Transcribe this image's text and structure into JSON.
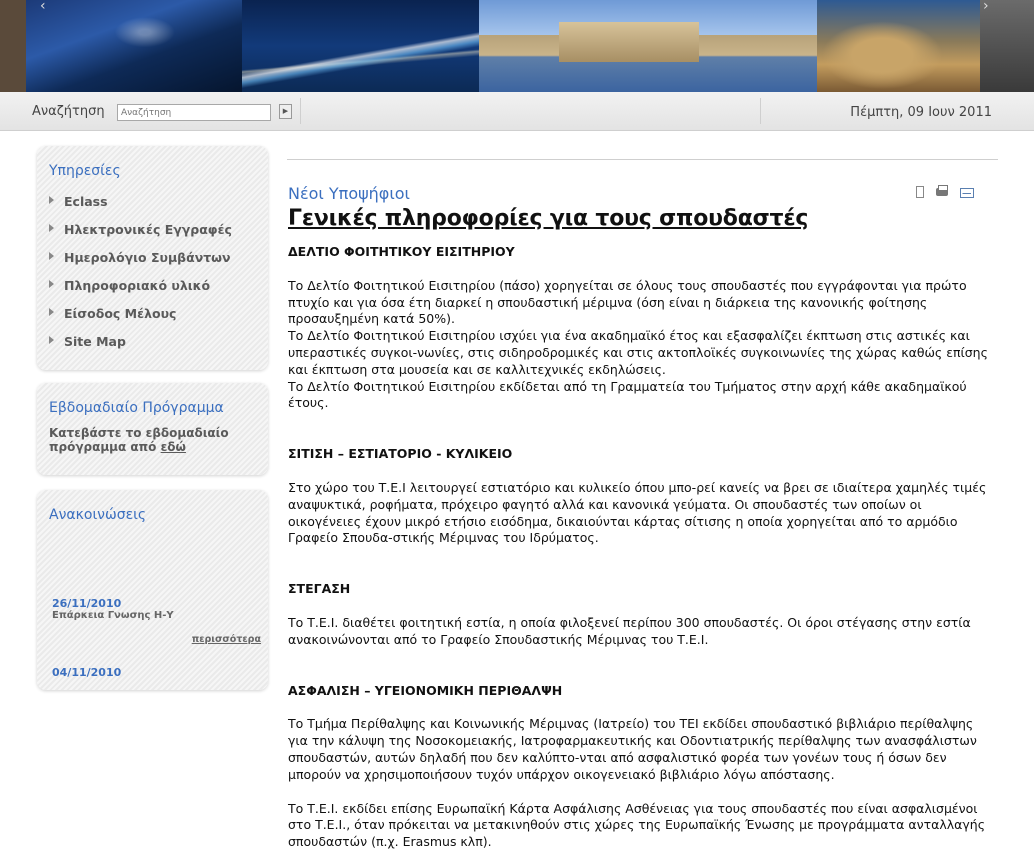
{
  "banner": {
    "arrow_left": "‹",
    "arrow_right": "›"
  },
  "search": {
    "label": "Αναζήτηση",
    "placeholder": "Αναζήτηση",
    "go_icon": "play-arrow-icon",
    "go_glyph": "▶",
    "date": "Πέμπτη, 09 Ιουν 2011"
  },
  "sidebar": {
    "services": {
      "title": "Υπηρεσίες",
      "items": [
        "Eclass",
        "Ηλεκτρονικές Εγγραφές",
        "Ημερολόγιο Συμβάντων",
        "Πληροφοριακό υλικό",
        "Είσοδος Μέλους",
        "Site Map"
      ]
    },
    "weekly": {
      "title": "Εβδομαδιαίο Πρόγραμμα",
      "text": "Κατεβάστε το εβδομαδιαίο πρόγραμμα από",
      "link": "εδώ"
    },
    "announcements": {
      "title": "Ανακοινώσεις",
      "items": [
        {
          "date": "26/11/2010",
          "text": "Επάρκεια Γνωσης Η-Υ"
        },
        {
          "date": "04/11/2010",
          "text": ""
        }
      ],
      "more": "περισσότερα"
    }
  },
  "main": {
    "section": "Νέοι Υποψήφιοι",
    "title": "Γενικές πληροφορίες για τους σπουδαστές",
    "icons": [
      "pdf-icon",
      "print-icon",
      "email-icon"
    ],
    "blocks": [
      {
        "heading": "ΔΕΛΤΙΟ ΦΟΙΤΗΤΙΚΟΥ ΕΙΣΙΤΗΡΙΟΥ",
        "paragraphs": [
          "Το Δελτίο Φοιτητικού Εισιτηρίου (πάσο) χορηγείται σε όλους τους σπουδαστές που εγγράφονται για πρώτο πτυχίο και για όσα έτη διαρκεί η σπουδαστική μέριμνα (όση είναι η διάρκεια της κανονικής φοίτησης προσαυξημένη κατά 50%).",
          "Το Δελτίο Φοιτητικού Εισιτηρίου ισχύει για ένα ακαδημαϊκό έτος και εξασφαλίζει έκπτωση στις αστικές και υπεραστικές συγκοι-νωνίες, στις σιδηροδρομικές και στις ακτοπλοϊκές συγκοινωνίες της χώρας καθώς επίσης και έκπτωση στα μουσεία και σε καλλιτεχνικές εκδηλώσεις.",
          "Το Δελτίο Φοιτητικού Εισιτηρίου εκδίδεται από τη Γραμματεία του Τμήματος στην αρχή κάθε ακαδημαϊκού έτους."
        ]
      },
      {
        "heading": "ΣΙΤΙΣΗ – ΕΣΤΙΑΤΟΡΙΟ - ΚΥΛΙΚΕΙΟ",
        "paragraphs": [
          "Στο χώρο του Τ.Ε.Ι λειτουργεί εστιατόριο και κυλικείο όπου μπο-ρεί κανείς να βρει σε ιδιαίτερα χαμηλές τιμές αναψυκτικά, ροφήματα, πρόχειρο φαγητό αλλά και κανονικά γεύματα. Οι σπουδαστές των οποίων οι οικογένειες έχουν μικρό ετήσιο εισόδημα, δικαιούνται κάρτας σίτισης η οποία χορηγείται από το αρμόδιο Γραφείο Σπουδα-στικής Μέριμνας του Ιδρύματος."
        ]
      },
      {
        "heading": "ΣΤΕΓΑΣΗ",
        "paragraphs": [
          "Το Τ.Ε.Ι. διαθέτει φοιτητική εστία, η οποία φιλοξενεί περίπου 300 σπουδαστές. Οι όροι στέγασης στην εστία ανακοινώνονται από το Γραφείο Σπουδαστικής Μέριμνας του Τ.Ε.Ι."
        ]
      },
      {
        "heading": "ΑΣΦΑΛΙΣΗ – ΥΓΕΙΟΝΟΜΙΚΗ ΠΕΡΙΘΑΛΨΗ",
        "paragraphs": [
          "Το Τμήμα Περίθαλψης και Κοινωνικής Μέριμνας (Ιατρείο) του ΤΕΙ εκδίδει σπουδαστικό βιβλιάριο περίθαλψης για την κάλυψη της Νοσοκομειακής, Ιατροφαρμακευτικής και Οδοντιατρικής περίθαλψης των ανασφάλιστων σπουδαστών, αυτών δηλαδή που δεν καλύπτο-νται από ασφαλιστικό φορέα των γονέων τους ή όσων δεν μπορούν να χρησιμοποιήσουν τυχόν υπάρχον οικογενειακό βιβλιάριο λόγω απόστασης.",
          "Το Τ.Ε.Ι. εκδίδει επίσης Ευρωπαϊκή Κάρτα Ασφάλισης Ασθένειας για τους σπουδαστές που είναι ασφαλισμένοι στο Τ.Ε.Ι., όταν πρόκειται να μετακινηθούν στις χώρες της Ευρωπαϊκής Ένωσης με προγράμματα ανταλλαγής σπουδαστών (π.χ. Erasmus κλπ)."
        ]
      }
    ]
  }
}
